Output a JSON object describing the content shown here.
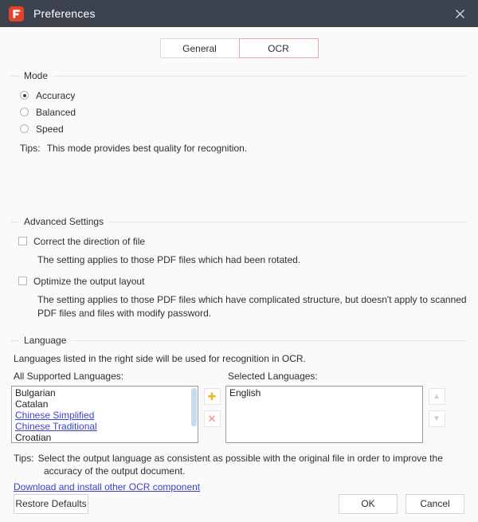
{
  "window": {
    "title": "Preferences",
    "logo_icon": "pdfelement-f-logo-icon",
    "close_icon": "close-icon",
    "accent_color": "#e8412a",
    "titlebar_color": "#3d424f"
  },
  "tabs": [
    {
      "label": "General",
      "active": false
    },
    {
      "label": "OCR",
      "active": true
    }
  ],
  "mode": {
    "group_title": "Mode",
    "options": [
      {
        "label": "Accuracy",
        "selected": true
      },
      {
        "label": "Balanced",
        "selected": false
      },
      {
        "label": "Speed",
        "selected": false
      }
    ],
    "tip_label": "Tips:",
    "tip_text": "This mode provides best quality for recognition."
  },
  "advanced": {
    "group_title": "Advanced Settings",
    "items": [
      {
        "label": "Correct the direction of file",
        "checked": false,
        "description": "The setting applies to those PDF files which had been rotated."
      },
      {
        "label": "Optimize the output layout",
        "checked": false,
        "description": "The setting applies to those PDF files which have complicated structure, but doesn't apply to scanned PDF files and files with modify password."
      }
    ]
  },
  "language": {
    "group_title": "Language",
    "intro": "Languages listed in the right side will be used for recognition in OCR.",
    "all_caption": "All Supported Languages:",
    "selected_caption": "Selected Languages:",
    "all_languages": [
      {
        "name": "Bulgarian",
        "link": false
      },
      {
        "name": "Catalan",
        "link": false
      },
      {
        "name": "Chinese Simplified",
        "link": true
      },
      {
        "name": "Chinese Traditional",
        "link": true
      },
      {
        "name": "Croatian",
        "link": false
      }
    ],
    "selected_languages": [
      {
        "name": "English"
      }
    ],
    "add_button": {
      "icon": "plus-icon",
      "glyph": "✚",
      "color": "#f0b429"
    },
    "remove_button": {
      "icon": "close-x-icon",
      "glyph": "✕",
      "color": "#e8897e"
    },
    "move_up_button": {
      "icon": "arrow-up-icon",
      "glyph": "▲",
      "color": "#b9d5ea"
    },
    "move_down_button": {
      "icon": "arrow-down-icon",
      "glyph": "▼",
      "color": "#b9d5ea"
    },
    "tip_label": "Tips:",
    "tip_line1": "Select the output language as consistent as possible with the original file in order to improve the",
    "tip_line2": "accuracy of the output document.",
    "download_link": "Download and install other OCR component"
  },
  "footer": {
    "restore_defaults": "Restore Defaults",
    "ok": "OK",
    "cancel": "Cancel"
  }
}
